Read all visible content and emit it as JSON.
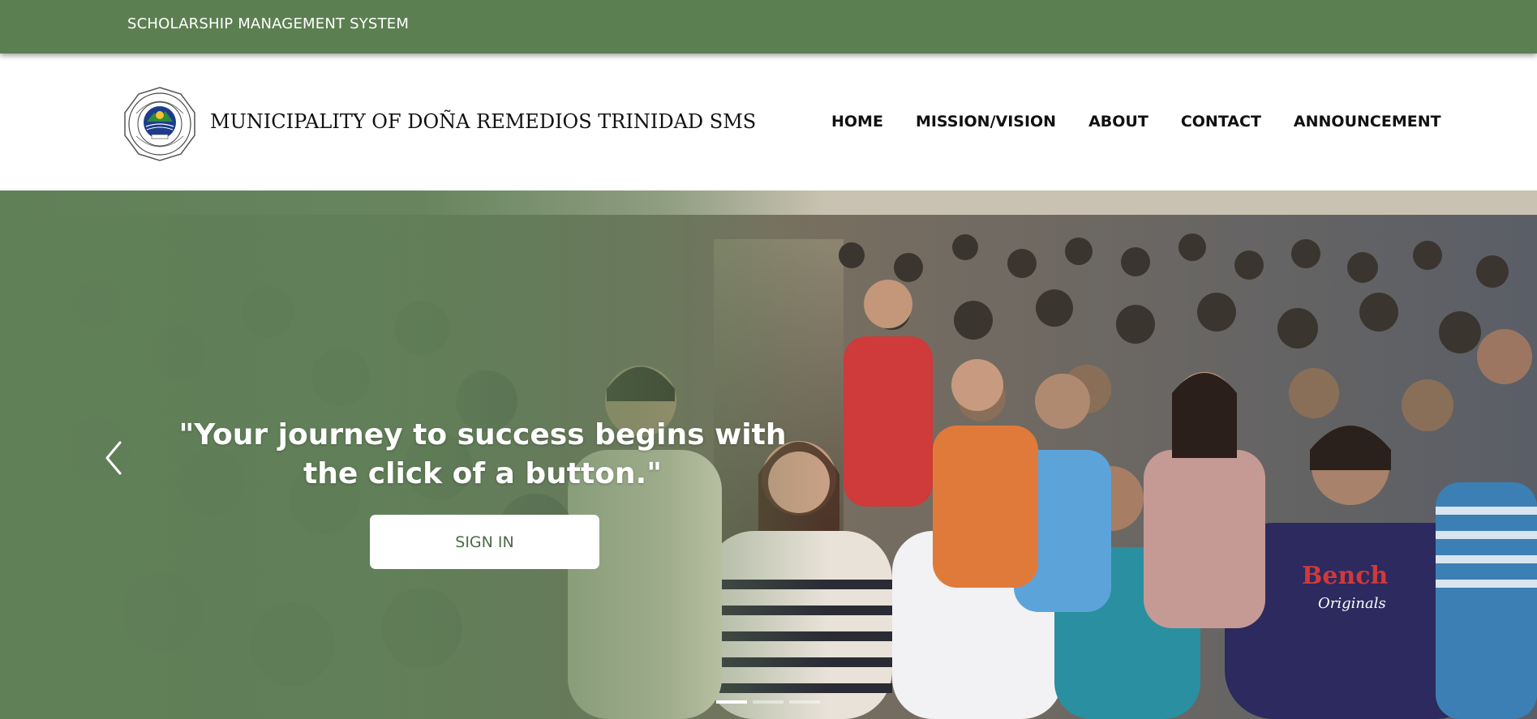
{
  "topbar": {
    "title": "SCHOLARSHIP MANAGEMENT SYSTEM"
  },
  "header": {
    "site_name": "MUNICIPALITY OF DOÑA REMEDIOS TRINIDAD SMS",
    "seal_icon": "municipal-seal-icon",
    "seal_text": {
      "top": "REPUBLIC OF THE PHILIPPINES",
      "bottom": "OFFICIAL SEAL",
      "year": "1977"
    },
    "nav": [
      {
        "label": "HOME"
      },
      {
        "label": "MISSION/VISION"
      },
      {
        "label": "ABOUT"
      },
      {
        "label": "CONTACT"
      },
      {
        "label": "ANNOUNCEMENT"
      }
    ]
  },
  "hero": {
    "quote": "\"Your journey to success begins with the click of a button.\"",
    "signin_label": "SIGN IN",
    "prev_icon": "chevron-left-icon",
    "slides_total": 3,
    "slide_active": 1
  },
  "colors": {
    "brand_green": "#5c7f52",
    "button_text": "#4f6b46",
    "nav_text": "#111111"
  }
}
